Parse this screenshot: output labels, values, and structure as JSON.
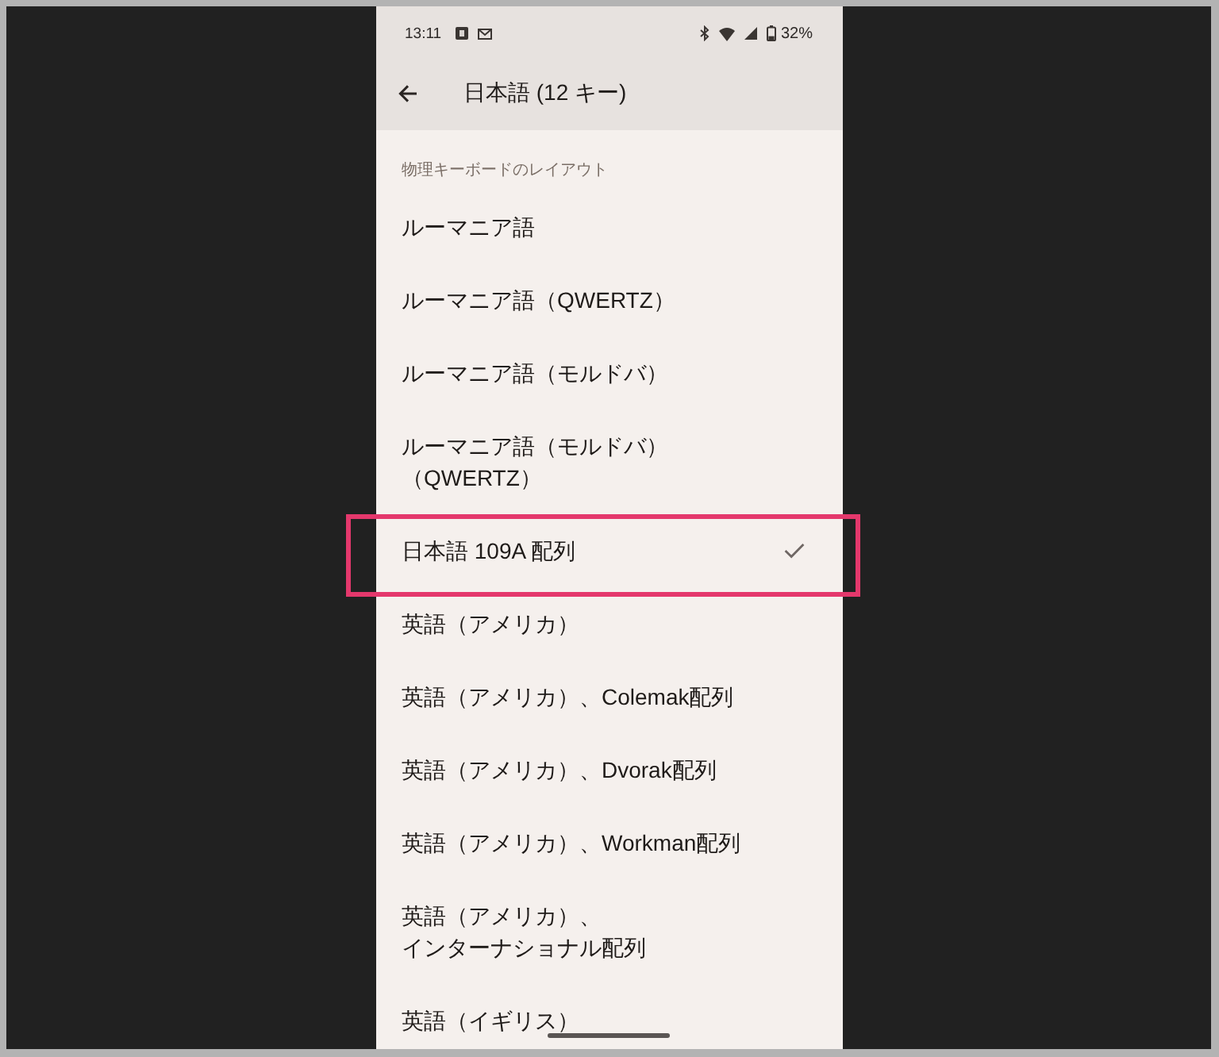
{
  "status_bar": {
    "time": "13:11",
    "battery": "32%"
  },
  "app_bar": {
    "title": "日本語 (12 キー)"
  },
  "section_header": "物理キーボードのレイアウト",
  "items": [
    {
      "label": "ルーマニア語",
      "selected": false,
      "highlighted": false
    },
    {
      "label": "ルーマニア語（QWERTZ）",
      "selected": false,
      "highlighted": false
    },
    {
      "label": "ルーマニア語（モルドバ）",
      "selected": false,
      "highlighted": false
    },
    {
      "label": "ルーマニア語（モルドバ）（QWERTZ）",
      "selected": false,
      "highlighted": false
    },
    {
      "label": "日本語 109A 配列",
      "selected": true,
      "highlighted": true
    },
    {
      "label": "英語（アメリカ）",
      "selected": false,
      "highlighted": false
    },
    {
      "label": "英語（アメリカ）、Colemak配列",
      "selected": false,
      "highlighted": false
    },
    {
      "label": "英語（アメリカ）、Dvorak配列",
      "selected": false,
      "highlighted": false
    },
    {
      "label": "英語（アメリカ）、Workman配列",
      "selected": false,
      "highlighted": false
    },
    {
      "label": "英語（アメリカ）、インターナショナル配列",
      "selected": false,
      "highlighted": false
    },
    {
      "label": "英語（イギリス）",
      "selected": false,
      "highlighted": false
    }
  ]
}
